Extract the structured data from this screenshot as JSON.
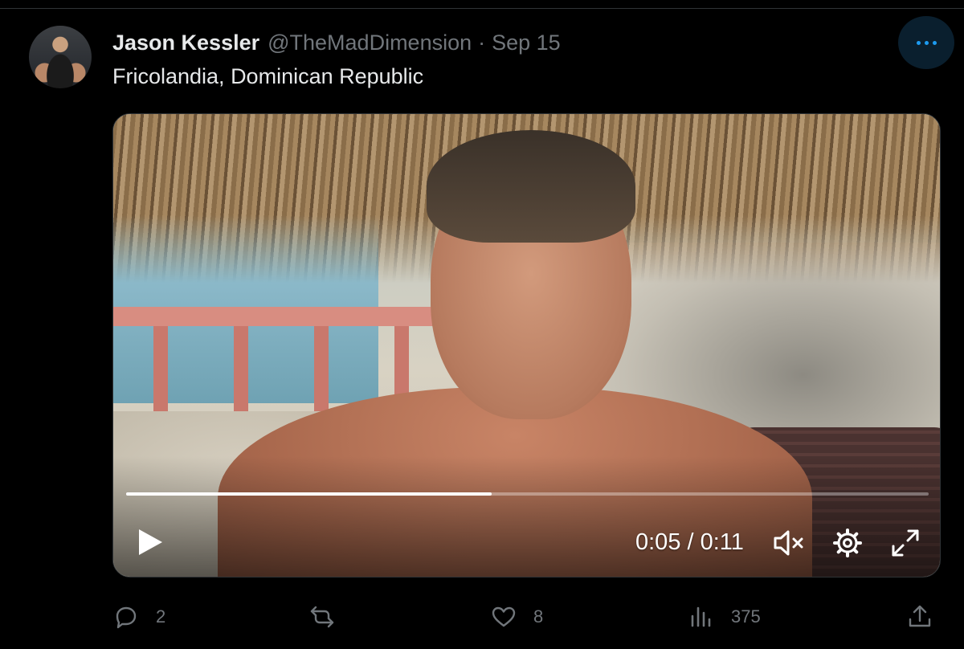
{
  "tweet": {
    "display_name": "Jason Kessler",
    "handle": "@TheMadDimension",
    "separator": "·",
    "date": "Sep 15",
    "text": "Fricolandia, Dominican Republic"
  },
  "more_icon": "more-dots-icon",
  "video": {
    "current_time": "0:05",
    "duration": "0:11",
    "time_label": "0:05 / 0:11",
    "progress_fraction": 0.455,
    "muted": true,
    "icons": [
      "play-icon",
      "muted-speaker-icon",
      "settings-gear-icon",
      "fullscreen-icon"
    ]
  },
  "actions": {
    "replies": "2",
    "reposts": "",
    "likes": "8",
    "views": "375",
    "icons": [
      "reply-icon",
      "repost-icon",
      "like-heart-icon",
      "views-chart-icon",
      "share-icon"
    ]
  },
  "colors": {
    "background": "#000000",
    "primary_text": "#e7e9ea",
    "secondary_text": "#71767b",
    "accent": "#1d9bf0"
  }
}
